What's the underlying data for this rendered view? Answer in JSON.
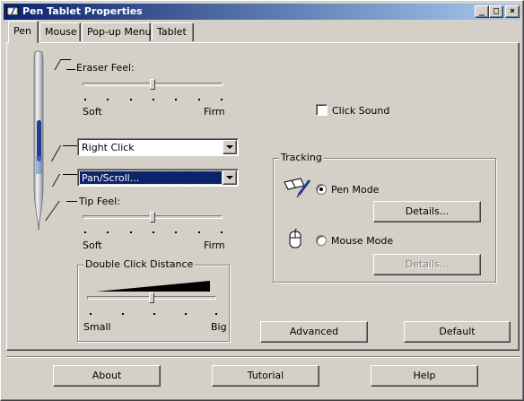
{
  "window": {
    "title": "Pen Tablet Properties",
    "minimize_label": "_",
    "maximize_label": "□",
    "close_label": "×"
  },
  "tabs": [
    {
      "label": "Pen",
      "active": true
    },
    {
      "label": "Mouse",
      "active": false
    },
    {
      "label": "Pop-up Menu",
      "active": false
    },
    {
      "label": "Tablet",
      "active": false
    }
  ],
  "pen": {
    "eraser_feel": {
      "label": "Eraser Feel:",
      "min_label": "Soft",
      "max_label": "Firm",
      "level": 0.5
    },
    "upper_button": {
      "value": "Right Click"
    },
    "lower_button": {
      "value": "Pan/Scroll..."
    },
    "tip_feel": {
      "label": "Tip Feel:",
      "min_label": "Soft",
      "max_label": "Firm",
      "level": 0.5
    },
    "double_click": {
      "label": "Double Click Distance",
      "min_label": "Small",
      "max_label": "Big",
      "level": 0.5
    },
    "click_sound": {
      "label": "Click Sound",
      "checked": false
    },
    "tracking": {
      "label": "Tracking",
      "pen_mode": {
        "label": "Pen Mode",
        "selected": true
      },
      "mouse_mode": {
        "label": "Mouse Mode",
        "selected": false
      },
      "details_label": "Details..."
    },
    "advanced_label": "Advanced",
    "default_label": "Default"
  },
  "footer": {
    "about_label": "About",
    "tutorial_label": "Tutorial",
    "help_label": "Help"
  },
  "colors": {
    "titlebar_start": "#0a246a",
    "titlebar_end": "#a6caf0",
    "face": "#d4d0c8",
    "selection": "#0a246a",
    "pen_blue": "#1f3f8f"
  }
}
